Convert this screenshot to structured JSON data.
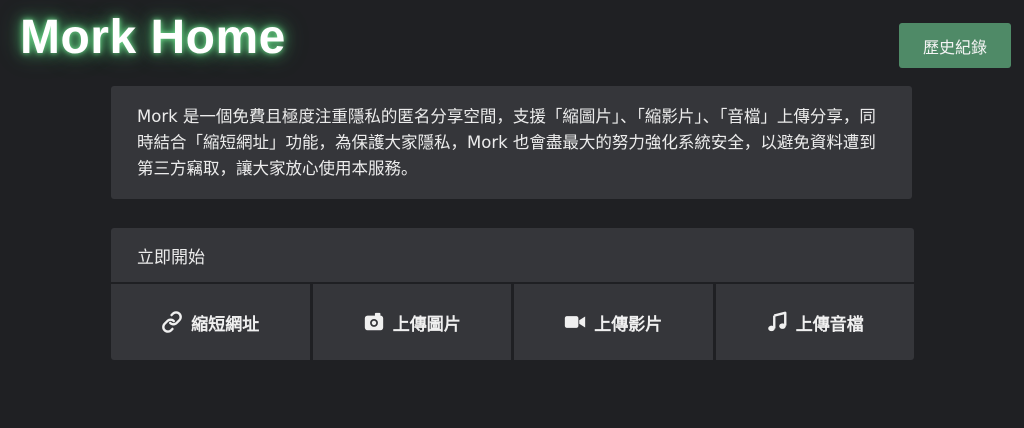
{
  "header": {
    "brand": "Mork Home",
    "history_label": "歷史紀錄"
  },
  "intro": {
    "text": "Mork 是一個免費且極度注重隱私的匿名分享空間，支援「縮圖片」、「縮影片」、「音檔」上傳分享，同時結合「縮短網址」功能，為保護大家隱私，Mork 也會盡最大的努力強化系統安全，以避免資料遭到第三方竊取，讓大家放心使用本服務。"
  },
  "start": {
    "title": "立即開始",
    "actions": [
      {
        "label": "縮短網址",
        "icon": "link-icon"
      },
      {
        "label": "上傳圖片",
        "icon": "camera-icon"
      },
      {
        "label": "上傳影片",
        "icon": "video-icon"
      },
      {
        "label": "上傳音檔",
        "icon": "music-icon"
      }
    ]
  },
  "colors": {
    "background": "#1f2023",
    "card": "#35363a",
    "accent": "#4f8a67",
    "glow": "#5adc82"
  }
}
